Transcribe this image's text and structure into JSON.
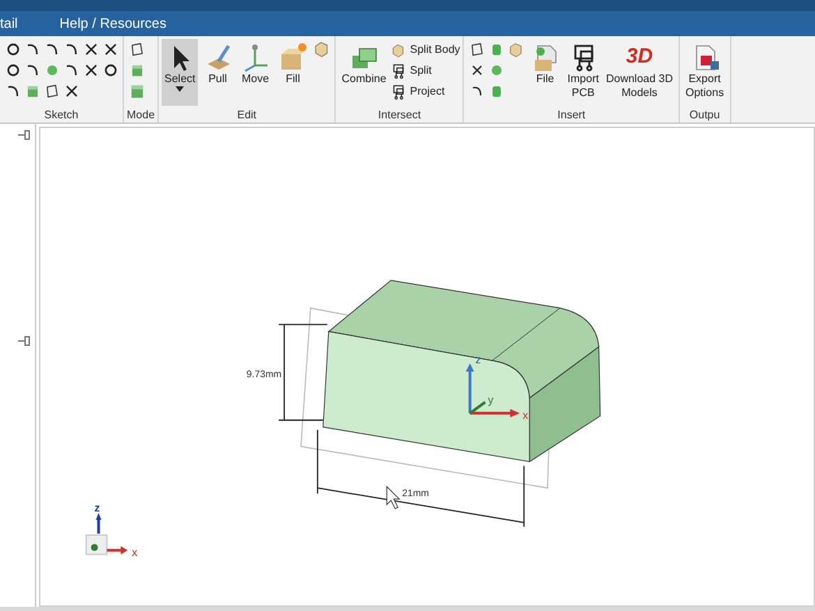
{
  "menu": [
    {
      "label": "tail"
    },
    {
      "label": "Help / Resources"
    }
  ],
  "ribbon": [
    {
      "label": "Sketch",
      "kind": "sketch"
    },
    {
      "label": "Mode",
      "kind": "mode"
    },
    {
      "label": "Edit",
      "kind": "edit",
      "tools": [
        {
          "label": "Select",
          "selected": true,
          "dropdown": true
        },
        {
          "label": "Pull",
          "selected": false
        },
        {
          "label": "Move",
          "selected": false
        },
        {
          "label": "Fill",
          "selected": false
        }
      ]
    },
    {
      "label": "Intersect",
      "kind": "intersect",
      "tools": [
        {
          "label": "Combine",
          "selected": false
        }
      ],
      "small": [
        {
          "label": "Split Body"
        },
        {
          "label": "Split"
        },
        {
          "label": "Project"
        }
      ]
    },
    {
      "label": "Insert",
      "kind": "insert",
      "tools": [
        {
          "label": "File",
          "selected": false
        },
        {
          "label": "Import\nPCB",
          "selected": false
        },
        {
          "label": "Download 3D\nModels",
          "selected": false,
          "badge": "3D"
        }
      ]
    },
    {
      "label": "Outpu",
      "kind": "output",
      "tools": [
        {
          "label": "Export\nOptions",
          "selected": false
        }
      ]
    }
  ],
  "viewport": {
    "height_dimension": "9.73mm",
    "width_dimension": "21mm",
    "part_axes": {
      "z": "z",
      "y": "y",
      "x": "x"
    },
    "view_axes": {
      "z": "z",
      "x": "x"
    }
  }
}
